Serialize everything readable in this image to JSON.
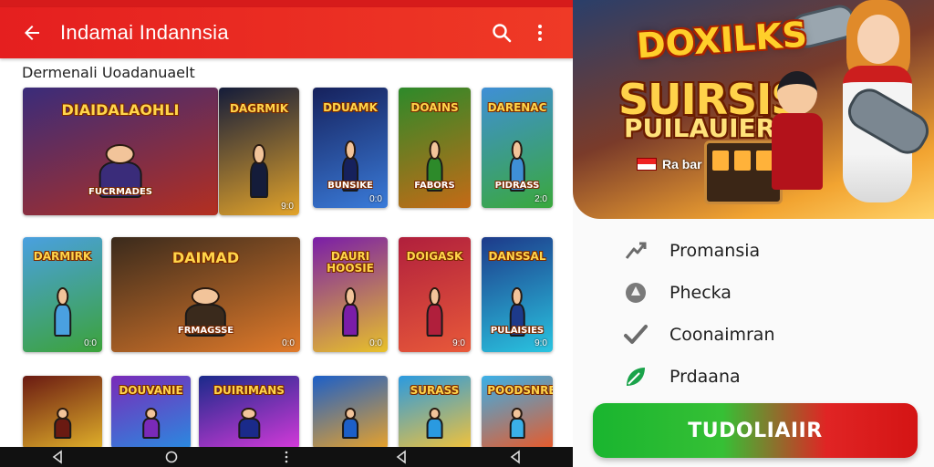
{
  "app_bar": {
    "title": "Indamai Indannsia",
    "back_icon": "arrow-left-icon",
    "search_icon": "search-icon",
    "menu_icon": "more-vert-icon",
    "color": "#e51f1f"
  },
  "section": {
    "title": "Dermenali Uoadanuaelt"
  },
  "tiles": [
    {
      "title": "DIAIDALAOHLI",
      "subtitle": "FUCRMADES",
      "price": "",
      "colors": [
        "#3a2c7a",
        "#b42f20"
      ]
    },
    {
      "title": "DAGRMIK",
      "subtitle": "",
      "price": "9:0",
      "colors": [
        "#141c3a",
        "#e2a32a"
      ]
    },
    {
      "title": "DDUAMK",
      "subtitle": "BUNSIKE",
      "price": "0:0",
      "colors": [
        "#16215c",
        "#3a7bd9"
      ]
    },
    {
      "title": "DOAINS",
      "subtitle": "FABORS",
      "price": "",
      "colors": [
        "#2d8a2a",
        "#c56a16"
      ]
    },
    {
      "title": "DARENAC",
      "subtitle": "PIDRASS",
      "price": "2:0",
      "colors": [
        "#3f8fd6",
        "#3aa83c"
      ]
    },
    {
      "title": "DARMIRK",
      "subtitle": "",
      "price": "0:0",
      "colors": [
        "#4aa0e0",
        "#3ca33a"
      ]
    },
    {
      "title": "DAIMAD",
      "subtitle": "FRMAGSSE",
      "price": "0:0",
      "colors": [
        "#3a2a1c",
        "#e07a2a"
      ]
    },
    {
      "title": "DAURI HOOSIE",
      "subtitle": "",
      "price": "0:0",
      "colors": [
        "#7a1da8",
        "#e8c12a"
      ]
    },
    {
      "title": "DOIGASK",
      "subtitle": "",
      "price": "9:0",
      "colors": [
        "#b01f3c",
        "#e8593a"
      ]
    },
    {
      "title": "DANSSAL",
      "subtitle": "PULAISIES",
      "price": "9:0",
      "colors": [
        "#1d3a8a",
        "#2ac4e0"
      ]
    },
    {
      "title": "",
      "subtitle": "",
      "price": "",
      "colors": [
        "#6a1a12",
        "#e0b02a"
      ]
    },
    {
      "title": "DOUVANIE",
      "subtitle": "",
      "price": "",
      "colors": [
        "#7a2ab8",
        "#2a8ae0"
      ]
    },
    {
      "title": "DUIRIMANS",
      "subtitle": "",
      "price": "",
      "colors": [
        "#1a2a8a",
        "#d43ad9"
      ]
    },
    {
      "title": "",
      "subtitle": "",
      "price": "",
      "colors": [
        "#1c5fc8",
        "#e8a22a"
      ]
    },
    {
      "title": "SURASS",
      "subtitle": "",
      "price": "",
      "colors": [
        "#2a9ae0",
        "#f2c23a"
      ]
    },
    {
      "title": "POODSNRE",
      "subtitle": "",
      "price": "",
      "colors": [
        "#3ab0e8",
        "#e85a2a"
      ]
    }
  ],
  "nav_bar": {
    "back_icon": "nav-back-icon",
    "home_icon": "nav-home-icon",
    "more_icon": "nav-more-icon",
    "recent_icon": "nav-recent-icon",
    "back2_icon": "nav-back-icon"
  },
  "banner": {
    "logo": "DOXILKS",
    "title": "SUIRSIS",
    "subtitle": "PUILAUIER",
    "tag": "Ra bar"
  },
  "menu": [
    {
      "label": "Promansia",
      "icon": "trend-icon"
    },
    {
      "label": "Phecka",
      "icon": "location-pin-icon"
    },
    {
      "label": "Coonaimran",
      "icon": "check-icon"
    },
    {
      "label": "Prdaana",
      "icon": "leaf-icon",
      "accent": "#1aa34a"
    }
  ],
  "cta": {
    "label": "TUDOLIAIIR",
    "colors": [
      "#19b52f",
      "#d41414"
    ]
  }
}
